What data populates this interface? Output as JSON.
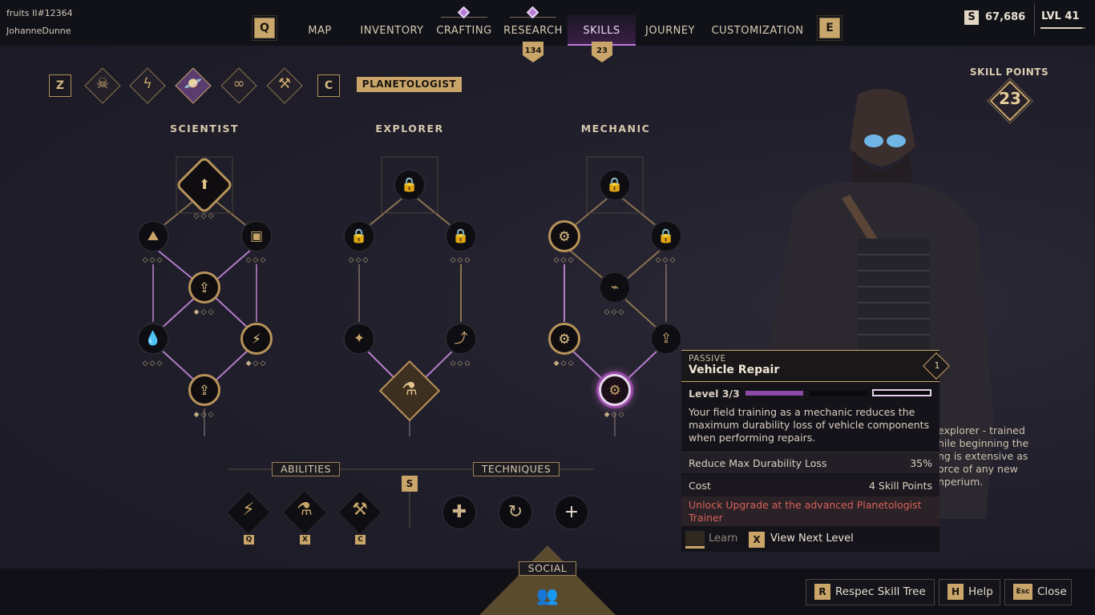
{
  "user": {
    "line1": "fruits II#12364",
    "line2": "JohanneDunne"
  },
  "nav": {
    "left_key": "Q",
    "right_key": "E",
    "tabs": [
      "MAP",
      "INVENTORY",
      "CRAFTING",
      "RESEARCH",
      "SKILLS",
      "JOURNEY",
      "CUSTOMIZATION"
    ],
    "active_tab": "SKILLS",
    "research_badge": "134",
    "skills_badge": "23"
  },
  "currency": {
    "icon": "S",
    "amount": "67,686"
  },
  "level": {
    "label": "LVL 41"
  },
  "categories": {
    "prev_key": "Z",
    "next_key": "C",
    "icons": [
      "skull-icon",
      "bolt-icon",
      "planet-icon",
      "infinity-icon",
      "crossed-tools-icon"
    ],
    "active_label": "PLANETOLOGIST"
  },
  "columns": [
    "SCIENTIST",
    "EXPLORER",
    "MECHANIC"
  ],
  "skill_points": {
    "label": "SKILL POINTS",
    "value": "23"
  },
  "tooltip": {
    "type": "PASSIVE",
    "title": "Vehicle Repair",
    "tier": "1",
    "level": "Level 3/3",
    "description": "Your field training as a mechanic reduces the maximum durability loss of vehicle components when performing repairs.",
    "stat_label": "Reduce Max Durability Loss",
    "stat_value": "35%",
    "cost_label": "Cost",
    "cost_value": "4 Skill Points",
    "warning": "Unlock Upgrade at the advanced Planetologist Trainer",
    "learn_label": "Learn",
    "view_key": "X",
    "view_label": "View Next Level"
  },
  "bg_description": {
    "lines": [
      "explorer - trained",
      "hile beginning the",
      "ng is extensive as",
      "orce of any new",
      "nperium."
    ]
  },
  "bottom": {
    "abilities_label": "ABILITIES",
    "techniques_label": "TECHNIQUES",
    "center_key": "S",
    "ability_keys": [
      "Q",
      "X",
      "C"
    ],
    "social_label": "SOCIAL",
    "buttons": [
      {
        "key": "R",
        "label": "Respec Skill Tree"
      },
      {
        "key": "H",
        "label": "Help"
      },
      {
        "key": "Esc",
        "label": "Close"
      }
    ]
  },
  "colors": {
    "gold": "#c9a56a",
    "purple": "#c27be0",
    "warning": "#d8605a"
  }
}
